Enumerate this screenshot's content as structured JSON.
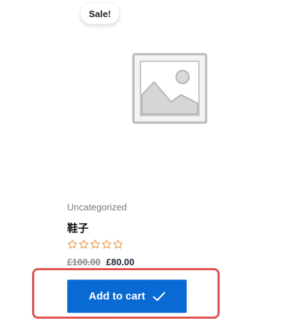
{
  "product": {
    "sale_badge": "Sale!",
    "category": "Uncategorized",
    "title": "鞋子",
    "rating": {
      "value": 0,
      "max": 5
    },
    "price_old": "£100.00",
    "price_new": "£80.00",
    "cart_button_label": "Add to cart",
    "cart_button_icon": "checkmark-icon",
    "image_icon": "image-placeholder-icon"
  },
  "colors": {
    "button": "#0a6ad4",
    "highlight": "#e05252",
    "star": "#e8994a"
  }
}
